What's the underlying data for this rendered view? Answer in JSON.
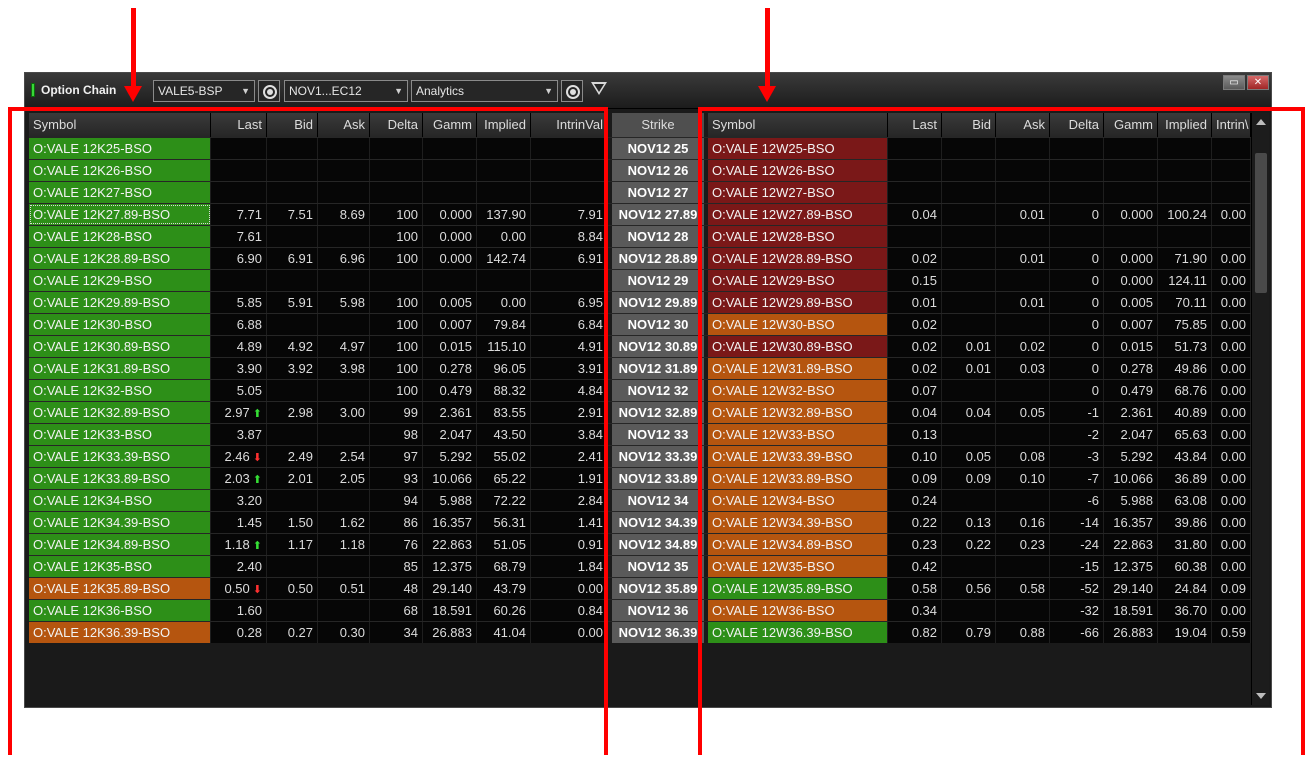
{
  "window": {
    "title": "Option Chain",
    "symbol_combo": "VALE5-BSP",
    "expiry_combo": "NOV1...EC12",
    "analytics_combo": "Analytics",
    "colors": {
      "green": "#2d8f18",
      "orange": "#b5550f",
      "maroon": "#7a1818",
      "strike_bg": "#5a5a5a",
      "annotation_red": "#ff0000"
    }
  },
  "left_headers": [
    "Symbol",
    "Last",
    "Bid",
    "Ask",
    "Delta",
    "Gamm",
    "Implied",
    "IntrinVal"
  ],
  "strike_header": "Strike",
  "right_headers": [
    "Symbol",
    "Last",
    "Bid",
    "Ask",
    "Delta",
    "Gamm",
    "Implied",
    "Intrin\\"
  ],
  "rows": [
    {
      "strike": "NOV12 25",
      "call": {
        "symbol": "O:VALE 12K25-BSO",
        "color": "green",
        "last": "",
        "tick": "",
        "bid": "",
        "ask": "",
        "delta": "",
        "gamma": "",
        "implied": "",
        "intrinsic": ""
      },
      "put": {
        "symbol": "O:VALE 12W25-BSO",
        "color": "maroon",
        "last": "",
        "bid": "",
        "ask": "",
        "delta": "",
        "gamma": "",
        "implied": "",
        "intrinsic": ""
      }
    },
    {
      "strike": "NOV12 26",
      "call": {
        "symbol": "O:VALE 12K26-BSO",
        "color": "green",
        "last": "",
        "tick": "",
        "bid": "",
        "ask": "",
        "delta": "",
        "gamma": "",
        "implied": "",
        "intrinsic": ""
      },
      "put": {
        "symbol": "O:VALE 12W26-BSO",
        "color": "maroon",
        "last": "",
        "bid": "",
        "ask": "",
        "delta": "",
        "gamma": "",
        "implied": "",
        "intrinsic": ""
      }
    },
    {
      "strike": "NOV12 27",
      "call": {
        "symbol": "O:VALE 12K27-BSO",
        "color": "green",
        "last": "",
        "tick": "",
        "bid": "",
        "ask": "",
        "delta": "",
        "gamma": "",
        "implied": "",
        "intrinsic": ""
      },
      "put": {
        "symbol": "O:VALE 12W27-BSO",
        "color": "maroon",
        "last": "",
        "bid": "",
        "ask": "",
        "delta": "",
        "gamma": "",
        "implied": "",
        "intrinsic": ""
      }
    },
    {
      "strike": "NOV12 27.89",
      "call": {
        "symbol": "O:VALE 12K27.89-BSO",
        "color": "selected",
        "last": "7.71",
        "tick": "",
        "bid": "7.51",
        "ask": "8.69",
        "delta": "100",
        "gamma": "0.000",
        "implied": "137.90",
        "intrinsic": "7.91"
      },
      "put": {
        "symbol": "O:VALE 12W27.89-BSO",
        "color": "maroon",
        "last": "0.04",
        "bid": "",
        "ask": "0.01",
        "delta": "0",
        "gamma": "0.000",
        "implied": "100.24",
        "intrinsic": "0.00"
      }
    },
    {
      "strike": "NOV12 28",
      "call": {
        "symbol": "O:VALE 12K28-BSO",
        "color": "green",
        "last": "7.61",
        "tick": "",
        "bid": "",
        "ask": "",
        "delta": "100",
        "gamma": "0.000",
        "implied": "0.00",
        "intrinsic": "8.84"
      },
      "put": {
        "symbol": "O:VALE 12W28-BSO",
        "color": "maroon",
        "last": "",
        "bid": "",
        "ask": "",
        "delta": "",
        "gamma": "",
        "implied": "",
        "intrinsic": ""
      }
    },
    {
      "strike": "NOV12 28.89",
      "call": {
        "symbol": "O:VALE 12K28.89-BSO",
        "color": "green",
        "last": "6.90",
        "tick": "",
        "bid": "6.91",
        "ask": "6.96",
        "delta": "100",
        "gamma": "0.000",
        "implied": "142.74",
        "intrinsic": "6.91"
      },
      "put": {
        "symbol": "O:VALE 12W28.89-BSO",
        "color": "maroon",
        "last": "0.02",
        "bid": "",
        "ask": "0.01",
        "delta": "0",
        "gamma": "0.000",
        "implied": "71.90",
        "intrinsic": "0.00"
      }
    },
    {
      "strike": "NOV12 29",
      "call": {
        "symbol": "O:VALE 12K29-BSO",
        "color": "green",
        "last": "",
        "tick": "",
        "bid": "",
        "ask": "",
        "delta": "",
        "gamma": "",
        "implied": "",
        "intrinsic": ""
      },
      "put": {
        "symbol": "O:VALE 12W29-BSO",
        "color": "maroon",
        "last": "0.15",
        "bid": "",
        "ask": "",
        "delta": "0",
        "gamma": "0.000",
        "implied": "124.11",
        "intrinsic": "0.00"
      }
    },
    {
      "strike": "NOV12 29.89",
      "call": {
        "symbol": "O:VALE 12K29.89-BSO",
        "color": "green",
        "last": "5.85",
        "tick": "",
        "bid": "5.91",
        "ask": "5.98",
        "delta": "100",
        "gamma": "0.005",
        "implied": "0.00",
        "intrinsic": "6.95"
      },
      "put": {
        "symbol": "O:VALE 12W29.89-BSO",
        "color": "maroon",
        "last": "0.01",
        "bid": "",
        "ask": "0.01",
        "delta": "0",
        "gamma": "0.005",
        "implied": "70.11",
        "intrinsic": "0.00"
      }
    },
    {
      "strike": "NOV12 30",
      "call": {
        "symbol": "O:VALE 12K30-BSO",
        "color": "green",
        "last": "6.88",
        "tick": "",
        "bid": "",
        "ask": "",
        "delta": "100",
        "gamma": "0.007",
        "implied": "79.84",
        "intrinsic": "6.84"
      },
      "put": {
        "symbol": "O:VALE 12W30-BSO",
        "color": "orange",
        "last": "0.02",
        "bid": "",
        "ask": "",
        "delta": "0",
        "gamma": "0.007",
        "implied": "75.85",
        "intrinsic": "0.00"
      }
    },
    {
      "strike": "NOV12 30.89",
      "call": {
        "symbol": "O:VALE 12K30.89-BSO",
        "color": "green",
        "last": "4.89",
        "tick": "",
        "bid": "4.92",
        "ask": "4.97",
        "delta": "100",
        "gamma": "0.015",
        "implied": "115.10",
        "intrinsic": "4.91"
      },
      "put": {
        "symbol": "O:VALE 12W30.89-BSO",
        "color": "maroon",
        "last": "0.02",
        "bid": "0.01",
        "ask": "0.02",
        "delta": "0",
        "gamma": "0.015",
        "implied": "51.73",
        "intrinsic": "0.00"
      }
    },
    {
      "strike": "NOV12 31.89",
      "call": {
        "symbol": "O:VALE 12K31.89-BSO",
        "color": "green",
        "last": "3.90",
        "tick": "",
        "bid": "3.92",
        "ask": "3.98",
        "delta": "100",
        "gamma": "0.278",
        "implied": "96.05",
        "intrinsic": "3.91"
      },
      "put": {
        "symbol": "O:VALE 12W31.89-BSO",
        "color": "orange",
        "last": "0.02",
        "bid": "0.01",
        "ask": "0.03",
        "delta": "0",
        "gamma": "0.278",
        "implied": "49.86",
        "intrinsic": "0.00"
      }
    },
    {
      "strike": "NOV12 32",
      "call": {
        "symbol": "O:VALE 12K32-BSO",
        "color": "green",
        "last": "5.05",
        "tick": "",
        "bid": "",
        "ask": "",
        "delta": "100",
        "gamma": "0.479",
        "implied": "88.32",
        "intrinsic": "4.84"
      },
      "put": {
        "symbol": "O:VALE 12W32-BSO",
        "color": "orange",
        "last": "0.07",
        "bid": "",
        "ask": "",
        "delta": "0",
        "gamma": "0.479",
        "implied": "68.76",
        "intrinsic": "0.00"
      }
    },
    {
      "strike": "NOV12 32.89",
      "call": {
        "symbol": "O:VALE 12K32.89-BSO",
        "color": "green",
        "last": "2.97",
        "tick": "up",
        "bid": "2.98",
        "ask": "3.00",
        "delta": "99",
        "gamma": "2.361",
        "implied": "83.55",
        "intrinsic": "2.91"
      },
      "put": {
        "symbol": "O:VALE 12W32.89-BSO",
        "color": "orange",
        "last": "0.04",
        "bid": "0.04",
        "ask": "0.05",
        "delta": "-1",
        "gamma": "2.361",
        "implied": "40.89",
        "intrinsic": "0.00"
      }
    },
    {
      "strike": "NOV12 33",
      "call": {
        "symbol": "O:VALE 12K33-BSO",
        "color": "green",
        "last": "3.87",
        "tick": "",
        "bid": "",
        "ask": "",
        "delta": "98",
        "gamma": "2.047",
        "implied": "43.50",
        "intrinsic": "3.84"
      },
      "put": {
        "symbol": "O:VALE 12W33-BSO",
        "color": "orange",
        "last": "0.13",
        "bid": "",
        "ask": "",
        "delta": "-2",
        "gamma": "2.047",
        "implied": "65.63",
        "intrinsic": "0.00"
      }
    },
    {
      "strike": "NOV12 33.39",
      "call": {
        "symbol": "O:VALE 12K33.39-BSO",
        "color": "green",
        "last": "2.46",
        "tick": "down",
        "bid": "2.49",
        "ask": "2.54",
        "delta": "97",
        "gamma": "5.292",
        "implied": "55.02",
        "intrinsic": "2.41"
      },
      "put": {
        "symbol": "O:VALE 12W33.39-BSO",
        "color": "orange",
        "last": "0.10",
        "bid": "0.05",
        "ask": "0.08",
        "delta": "-3",
        "gamma": "5.292",
        "implied": "43.84",
        "intrinsic": "0.00"
      }
    },
    {
      "strike": "NOV12 33.89",
      "call": {
        "symbol": "O:VALE 12K33.89-BSO",
        "color": "green",
        "last": "2.03",
        "tick": "up",
        "bid": "2.01",
        "ask": "2.05",
        "delta": "93",
        "gamma": "10.066",
        "implied": "65.22",
        "intrinsic": "1.91"
      },
      "put": {
        "symbol": "O:VALE 12W33.89-BSO",
        "color": "orange",
        "last": "0.09",
        "bid": "0.09",
        "ask": "0.10",
        "delta": "-7",
        "gamma": "10.066",
        "implied": "36.89",
        "intrinsic": "0.00"
      }
    },
    {
      "strike": "NOV12 34",
      "call": {
        "symbol": "O:VALE 12K34-BSO",
        "color": "green",
        "last": "3.20",
        "tick": "",
        "bid": "",
        "ask": "",
        "delta": "94",
        "gamma": "5.988",
        "implied": "72.22",
        "intrinsic": "2.84"
      },
      "put": {
        "symbol": "O:VALE 12W34-BSO",
        "color": "orange",
        "last": "0.24",
        "bid": "",
        "ask": "",
        "delta": "-6",
        "gamma": "5.988",
        "implied": "63.08",
        "intrinsic": "0.00"
      }
    },
    {
      "strike": "NOV12 34.39",
      "call": {
        "symbol": "O:VALE 12K34.39-BSO",
        "color": "green",
        "last": "1.45",
        "tick": "",
        "bid": "1.50",
        "ask": "1.62",
        "delta": "86",
        "gamma": "16.357",
        "implied": "56.31",
        "intrinsic": "1.41"
      },
      "put": {
        "symbol": "O:VALE 12W34.39-BSO",
        "color": "orange",
        "last": "0.22",
        "bid": "0.13",
        "ask": "0.16",
        "delta": "-14",
        "gamma": "16.357",
        "implied": "39.86",
        "intrinsic": "0.00"
      }
    },
    {
      "strike": "NOV12 34.89",
      "call": {
        "symbol": "O:VALE 12K34.89-BSO",
        "color": "green",
        "last": "1.18",
        "tick": "up",
        "bid": "1.17",
        "ask": "1.18",
        "delta": "76",
        "gamma": "22.863",
        "implied": "51.05",
        "intrinsic": "0.91"
      },
      "put": {
        "symbol": "O:VALE 12W34.89-BSO",
        "color": "orange",
        "last": "0.23",
        "bid": "0.22",
        "ask": "0.23",
        "delta": "-24",
        "gamma": "22.863",
        "implied": "31.80",
        "intrinsic": "0.00"
      }
    },
    {
      "strike": "NOV12 35",
      "call": {
        "symbol": "O:VALE 12K35-BSO",
        "color": "green",
        "last": "2.40",
        "tick": "",
        "bid": "",
        "ask": "",
        "delta": "85",
        "gamma": "12.375",
        "implied": "68.79",
        "intrinsic": "1.84"
      },
      "put": {
        "symbol": "O:VALE 12W35-BSO",
        "color": "orange",
        "last": "0.42",
        "bid": "",
        "ask": "",
        "delta": "-15",
        "gamma": "12.375",
        "implied": "60.38",
        "intrinsic": "0.00"
      }
    },
    {
      "strike": "NOV12 35.89",
      "call": {
        "symbol": "O:VALE 12K35.89-BSO",
        "color": "orange",
        "last": "0.50",
        "tick": "down",
        "bid": "0.50",
        "ask": "0.51",
        "delta": "48",
        "gamma": "29.140",
        "implied": "43.79",
        "intrinsic": "0.00"
      },
      "put": {
        "symbol": "O:VALE 12W35.89-BSO",
        "color": "green",
        "last": "0.58",
        "bid": "0.56",
        "ask": "0.58",
        "delta": "-52",
        "gamma": "29.140",
        "implied": "24.84",
        "intrinsic": "0.09"
      }
    },
    {
      "strike": "NOV12 36",
      "call": {
        "symbol": "O:VALE 12K36-BSO",
        "color": "green",
        "last": "1.60",
        "tick": "",
        "bid": "",
        "ask": "",
        "delta": "68",
        "gamma": "18.591",
        "implied": "60.26",
        "intrinsic": "0.84"
      },
      "put": {
        "symbol": "O:VALE 12W36-BSO",
        "color": "orange",
        "last": "0.34",
        "bid": "",
        "ask": "",
        "delta": "-32",
        "gamma": "18.591",
        "implied": "36.70",
        "intrinsic": "0.00"
      }
    },
    {
      "strike": "NOV12 36.39",
      "call": {
        "symbol": "O:VALE 12K36.39-BSO",
        "color": "orange",
        "last": "0.28",
        "tick": "",
        "bid": "0.27",
        "ask": "0.30",
        "delta": "34",
        "gamma": "26.883",
        "implied": "41.04",
        "intrinsic": "0.00"
      },
      "put": {
        "symbol": "O:VALE 12W36.39-BSO",
        "color": "green",
        "last": "0.82",
        "bid": "0.79",
        "ask": "0.88",
        "delta": "-66",
        "gamma": "26.883",
        "implied": "19.04",
        "intrinsic": "0.59"
      }
    }
  ]
}
